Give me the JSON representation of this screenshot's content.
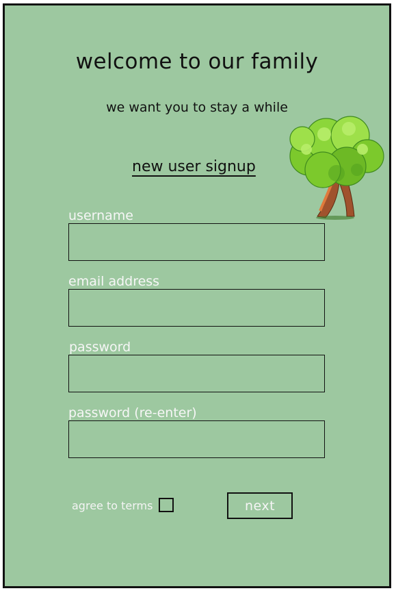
{
  "header": {
    "title": "welcome to our family",
    "subtitle": "we want you to stay a while",
    "section_title": "new user signup"
  },
  "illustration": {
    "icon": "tree-icon"
  },
  "form": {
    "fields": [
      {
        "label": "username",
        "value": "",
        "placeholder": ""
      },
      {
        "label": "email address",
        "value": "",
        "placeholder": ""
      },
      {
        "label": "password",
        "value": "",
        "placeholder": ""
      },
      {
        "label": "password (re-enter)",
        "value": "",
        "placeholder": ""
      }
    ],
    "terms_label": "agree to terms",
    "terms_checked": false,
    "next_label": "next"
  },
  "colors": {
    "background": "#9dc8a0",
    "border": "#111111",
    "label_text": "#f6f6f6",
    "heading_text": "#111111",
    "tree_foliage": "#8cd63a",
    "tree_trunk": "#a0522d"
  }
}
